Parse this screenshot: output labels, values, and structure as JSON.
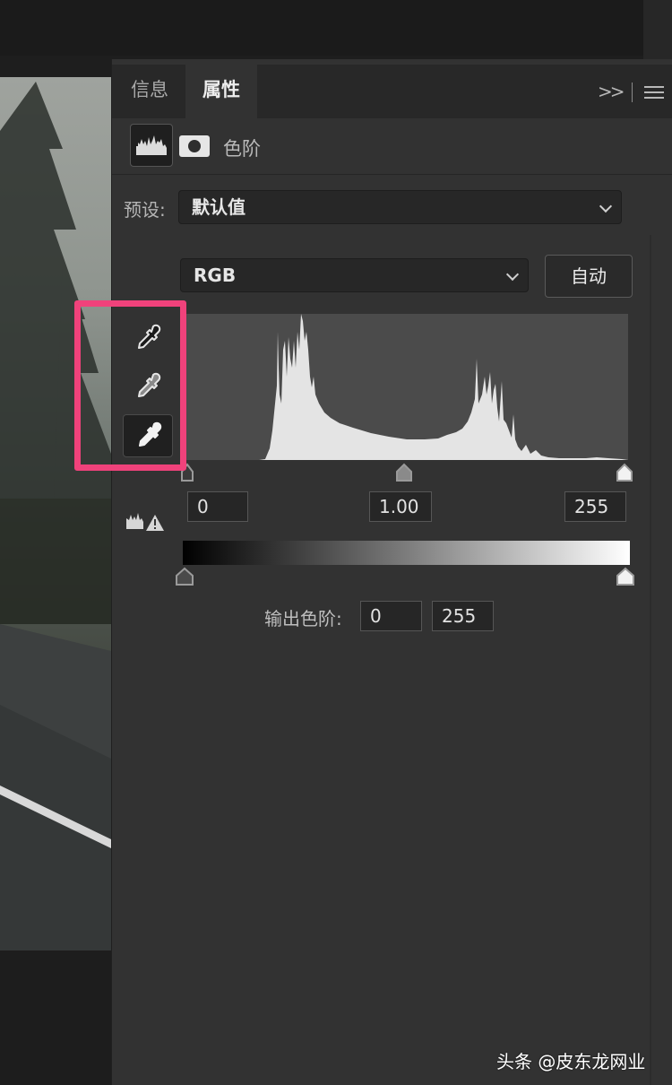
{
  "colors": {
    "panel_bg": "#323232",
    "tabbar_bg": "#282828",
    "highlight": "#f0427b",
    "histogram_bg": "#4b4b4b",
    "histogram_fill": "#e4e4e4"
  },
  "tabs": [
    {
      "label": "信息",
      "active": false
    },
    {
      "label": "属性",
      "active": true
    }
  ],
  "panel_menu": {
    "collapse_icon": "double-chevron-right-icon",
    "menu_icon": "hamburger-menu-icon"
  },
  "adjustment": {
    "title": "色阶",
    "layer_icon": "levels-histogram-icon",
    "mask_icon": "layer-mask-icon"
  },
  "preset": {
    "label": "预设:",
    "value": "默认值"
  },
  "channel": {
    "value": "RGB"
  },
  "auto_button": {
    "label": "自动"
  },
  "eyedroppers": [
    {
      "name": "black-point-eyedropper",
      "icon": "eyedropper-icon",
      "active": false
    },
    {
      "name": "gray-point-eyedropper",
      "icon": "eyedropper-icon",
      "active": false
    },
    {
      "name": "white-point-eyedropper",
      "icon": "eyedropper-icon",
      "active": true
    }
  ],
  "input_levels": {
    "black": "0",
    "gamma": "1.00",
    "white": "255"
  },
  "output_levels": {
    "label": "输出色阶:",
    "black": "0",
    "white": "255"
  },
  "clipping_icon": "clipping-warning-icon",
  "watermark": "头条 @皮东龙网业"
}
